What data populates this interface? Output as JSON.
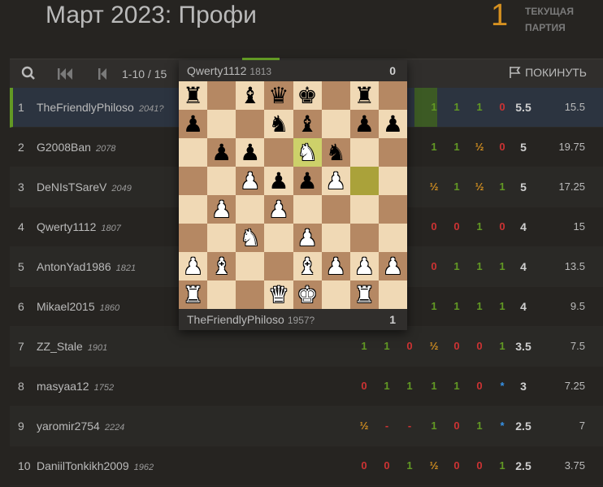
{
  "header": {
    "title": "Март 2023: Профи",
    "game_number": "1",
    "game_label_line1": "ТЕКУЩАЯ",
    "game_label_line2": "ПАРТИЯ"
  },
  "controls": {
    "pager": "1-10 / 15",
    "leave_label": "ПОКИНУТЬ"
  },
  "colors": {
    "win": "#629924",
    "loss": "#cc3333",
    "draw": "#d59020",
    "star": "#3692e7",
    "accent": "#d59020"
  },
  "rows": [
    {
      "rank": "1",
      "name": "TheFriendlyPhiloso",
      "rating": "2041?",
      "results": [
        "1",
        "1",
        "1",
        "0"
      ],
      "points": "5.5",
      "tiebreak": "15.5"
    },
    {
      "rank": "2",
      "name": "G2008Ban",
      "rating": "2078",
      "results": [
        "1",
        "1",
        "½",
        "0"
      ],
      "points": "5",
      "tiebreak": "19.75"
    },
    {
      "rank": "3",
      "name": "DeNIsTSareV",
      "rating": "2049",
      "results": [
        "½",
        "1",
        "½",
        "1"
      ],
      "points": "5",
      "tiebreak": "17.25"
    },
    {
      "rank": "4",
      "name": "Qwerty1112",
      "rating": "1807",
      "results": [
        "0",
        "0",
        "1",
        "0"
      ],
      "points": "4",
      "tiebreak": "15"
    },
    {
      "rank": "5",
      "name": "AntonYad1986",
      "rating": "1821",
      "results": [
        "0",
        "1",
        "1",
        "1"
      ],
      "points": "4",
      "tiebreak": "13.5"
    },
    {
      "rank": "6",
      "name": "Mikael2015",
      "rating": "1860",
      "results": [
        "1",
        "1",
        "1",
        "1"
      ],
      "points": "4",
      "tiebreak": "9.5"
    },
    {
      "rank": "7",
      "name": "ZZ_Stale",
      "rating": "1901",
      "results": [
        "1",
        "1",
        "0",
        "½",
        "0",
        "0",
        "1"
      ],
      "points": "3.5",
      "tiebreak": "7.5"
    },
    {
      "rank": "8",
      "name": "masyaa12",
      "rating": "1752",
      "results": [
        "0",
        "1",
        "1",
        "1",
        "1",
        "0",
        "*"
      ],
      "points": "3",
      "tiebreak": "7.25"
    },
    {
      "rank": "9",
      "name": "yaromir2754",
      "rating": "2224",
      "results": [
        "½",
        "-",
        "-",
        "1",
        "0",
        "1",
        "*"
      ],
      "points": "2.5",
      "tiebreak": "7"
    },
    {
      "rank": "10",
      "name": "DaniilTonkikh2009",
      "rating": "1962",
      "results": [
        "0",
        "0",
        "1",
        "½",
        "0",
        "0",
        "1"
      ],
      "points": "2.5",
      "tiebreak": "3.75"
    }
  ],
  "popup": {
    "top_player": {
      "name": "Qwerty1112",
      "rating": "1813",
      "score": "0"
    },
    "bottom_player": {
      "name": "TheFriendlyPhiloso",
      "rating": "1957?",
      "score": "1"
    },
    "board": [
      [
        "bR",
        "",
        "bB",
        "bQ",
        "bK",
        "",
        "bR",
        ""
      ],
      [
        "bP",
        "",
        "",
        "bN",
        "bB",
        "",
        "bP",
        "bP"
      ],
      [
        "",
        "bP",
        "bP",
        "",
        "wN",
        "bN",
        "",
        ""
      ],
      [
        "",
        "",
        "wP",
        "bP",
        "bP",
        "wP",
        "",
        ""
      ],
      [
        "",
        "wP",
        "",
        "wP",
        "",
        "",
        "",
        ""
      ],
      [
        "",
        "",
        "wN",
        "",
        "wP",
        "",
        "",
        ""
      ],
      [
        "wP",
        "wB",
        "",
        "",
        "wB",
        "wP",
        "wP",
        "wP"
      ],
      [
        "wR",
        "",
        "",
        "wQ",
        "wK",
        "",
        "wR",
        ""
      ]
    ],
    "highlights": [
      [
        2,
        4
      ],
      [
        3,
        6
      ]
    ]
  }
}
